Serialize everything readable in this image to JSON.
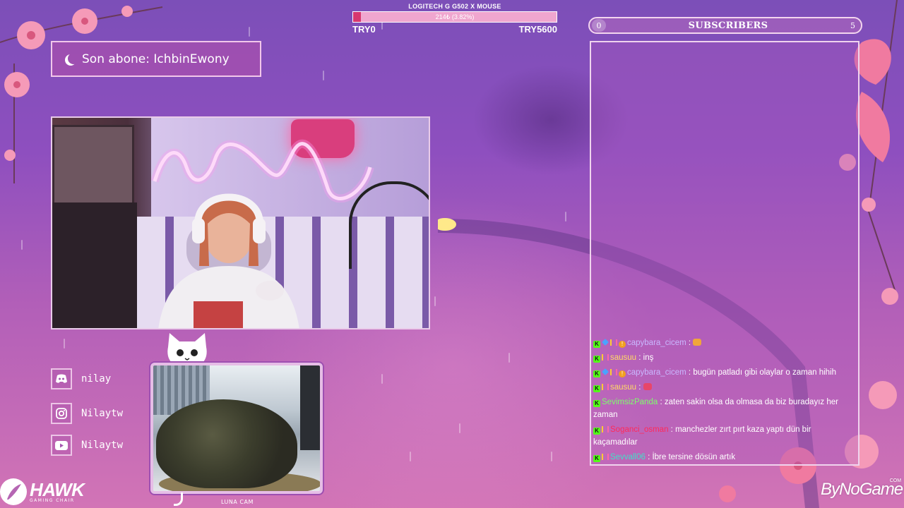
{
  "goal": {
    "title": "LOGITECH G G502 X MOUSE",
    "progress_text": "214₺ (3.82%)",
    "progress_fraction": 0.0382,
    "start": "TRY0",
    "end": "TRY5600"
  },
  "last_sub": {
    "text": "Son abone: IchbinEwony"
  },
  "socials": [
    {
      "icon": "discord-icon",
      "label": "nilay"
    },
    {
      "icon": "instagram-icon",
      "label": "Nilaytw"
    },
    {
      "icon": "youtube-icon",
      "label": "Nilaytw"
    }
  ],
  "catcam": {
    "label": "LUNA CAM"
  },
  "subscribers": {
    "count": "0",
    "title": "SUBSCRIBERS",
    "goal": "5"
  },
  "chat": [
    {
      "badges": [
        "kick",
        "diamond",
        "sub",
        "gift"
      ],
      "user": "capybara_cicem",
      "color": "#c9b8ff",
      "text": " : ",
      "emote": true
    },
    {
      "badges": [
        "kick",
        "sub"
      ],
      "user": "sausuu",
      "color": "#ffd966",
      "text": " : inş"
    },
    {
      "badges": [
        "kick",
        "diamond",
        "sub",
        "gift"
      ],
      "user": "capybara_cicem",
      "color": "#c9b8ff",
      "text": " : bugün patladı gibi olaylar o zaman hihih"
    },
    {
      "badges": [
        "kick",
        "sub"
      ],
      "user": "sausuu",
      "color": "#ffd966",
      "text": " : ",
      "emote": true
    },
    {
      "badges": [
        "kick"
      ],
      "user": "SevimsizPanda",
      "color": "#7dff6b",
      "text": " : zaten sakin olsa da olmasa da biz buradayız her zaman"
    },
    {
      "badges": [
        "kick",
        "sub"
      ],
      "user": "Soganci_osman",
      "color": "#ff2a5a",
      "text": " : manchezler zırt pırt kaza yaptı dün bir kaçamadılar"
    },
    {
      "badges": [
        "kick",
        "sub"
      ],
      "user": "Sevvall06",
      "color": "#40e0c8",
      "text": " : İbre tersine dösün artık"
    }
  ],
  "logos": {
    "hawk_name": "HAWK",
    "hawk_sub": "GAMING CHAIR",
    "bynogame": "ByNoGame",
    "bynogame_suffix": "COM"
  },
  "colors": {
    "goal_fill": "#d8376f",
    "frame": "#f0d4ee",
    "kick_green": "#53fc18"
  }
}
